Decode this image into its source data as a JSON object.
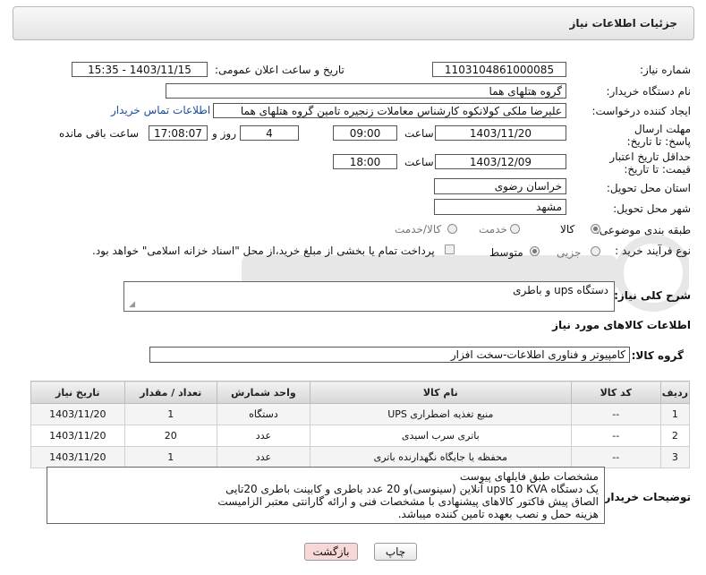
{
  "header": {
    "title": "جزئیات اطلاعات نیاز"
  },
  "form": {
    "need_number_label": "شماره نیاز:",
    "need_number": "1103104861000085",
    "announce_label": "تاریخ و ساعت اعلان عمومی:",
    "announce_value": "1403/11/15 - 15:35",
    "buyer_org_label": "نام دستگاه خریدار:",
    "buyer_org": "گروه هتلهای هما",
    "requester_label": "ایجاد کننده درخواست:",
    "requester": "علیرضا ملکی کولانکوه کارشناس معاملات زنجیره تامین گروه هتلهای هما",
    "contact_link": "اطلاعات تماس خریدار",
    "reply_deadline_label": "مهلت ارسال پاسخ: تا تاریخ:",
    "reply_date": "1403/11/20",
    "time_label": "ساعت",
    "reply_time": "09:00",
    "days_value": "4",
    "days_label": "روز و",
    "remaining_time": "17:08:07",
    "remaining_label": "ساعت باقی مانده",
    "price_validity_label": "حداقل تاریخ اعتبار قیمت: تا تاریخ:",
    "validity_date": "1403/12/09",
    "validity_time": "18:00",
    "province_label": "استان محل تحویل:",
    "province": "خراسان رضوی",
    "city_label": "شهر محل تحویل:",
    "city": "مشهد",
    "category_label": "طبقه بندی موضوعی:",
    "category_options": [
      "کالا",
      "خدمت",
      "کالا/خدمت"
    ],
    "process_label": "نوع فرآیند خرید :",
    "process_options": [
      "جزیی",
      "متوسط"
    ],
    "payment_note": "پرداخت تمام یا بخشی از مبلغ خرید،از محل \"اسناد خزانه اسلامی\" خواهد بود.",
    "summary_label": "شرح کلی نیاز:",
    "summary": "دستگاه ups و باطری",
    "goods_info_title": "اطلاعات کالاهای مورد نیاز",
    "goods_group_label": "گروه کالا:",
    "goods_group": "کامپیوتر و فناوری اطلاعات-سخت افزار"
  },
  "table": {
    "headers": [
      "ردیف",
      "کد کالا",
      "نام کالا",
      "واحد شمارش",
      "تعداد / مقدار",
      "تاریخ نیاز"
    ],
    "rows": [
      [
        "1",
        "--",
        "منبع تغذیه اضطراری UPS",
        "دستگاه",
        "1",
        "1403/11/20"
      ],
      [
        "2",
        "--",
        "باتری سرب اسیدی",
        "عدد",
        "20",
        "1403/11/20"
      ],
      [
        "3",
        "--",
        "محفظه یا جایگاه نگهدارنده باتری",
        "عدد",
        "1",
        "1403/11/20"
      ]
    ]
  },
  "buyer_notes": {
    "label": "توضیحات خریدار:",
    "lines": [
      "مشخصات طبق فایلهای پیوست",
      "یک دستگاه ups 10 KVA آنلاین (سینوسی)و 20 عدد باطری و کابینت باطری 20تایی",
      "الصاق پیش فاکتور کالاهای پیشنهادی با مشخصات فنی و ارائه گارانتی معتبر الزامیست",
      "هزینه حمل و نصب بعهده تامین کننده میباشد."
    ]
  },
  "buttons": {
    "print": "چاپ",
    "back": "بازگشت"
  },
  "colors": {
    "back_button_bg": "#f8d7d7",
    "link": "#1a4fa0"
  }
}
